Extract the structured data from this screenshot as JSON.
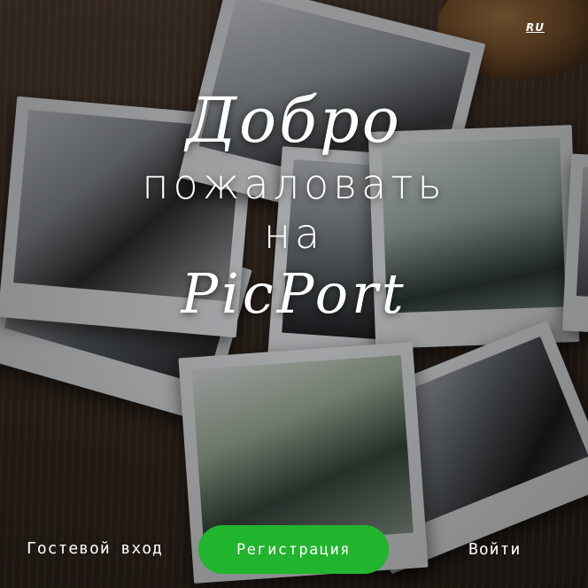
{
  "language_switch": {
    "label": "RU"
  },
  "welcome": {
    "line1": "Добро",
    "line2": "пожаловать",
    "line3": "на",
    "line4": "PicPort"
  },
  "actions": {
    "guest_label": "Гостевой вход",
    "register_label": "Регистрация",
    "login_label": "Войти"
  },
  "colors": {
    "accent": "#21b42d",
    "text": "#ffffff"
  }
}
